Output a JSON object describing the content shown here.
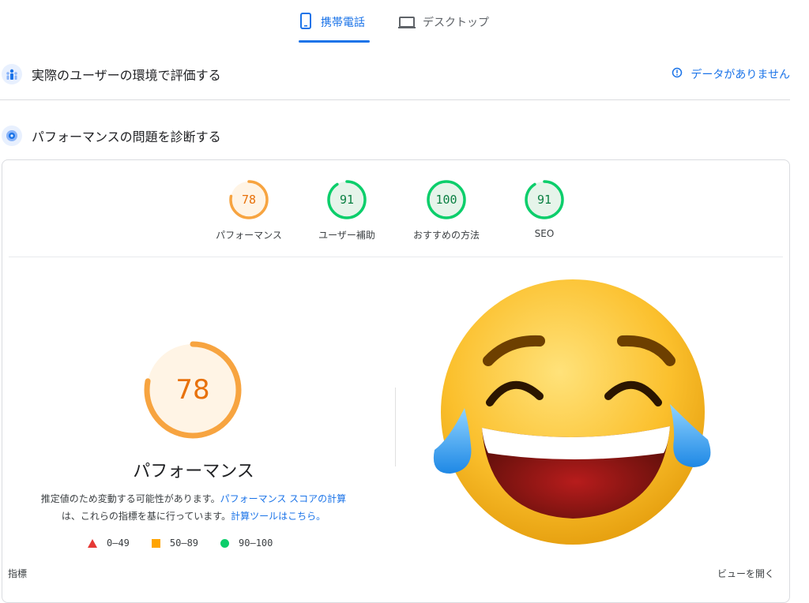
{
  "tabs": {
    "mobile": "携帯電話",
    "desktop": "デスクトップ"
  },
  "field_section": {
    "title": "実際のユーザーの環境で評価する",
    "no_data": "データがありません"
  },
  "lab_section": {
    "title": "パフォーマンスの問題を診断する"
  },
  "scores": [
    {
      "value": "78",
      "label": "パフォーマンス",
      "color": "#e8710a",
      "bg": "#fff4e5",
      "stroke": "#f7a440",
      "fraction": 0.78
    },
    {
      "value": "91",
      "label": "ユーザー補助",
      "color": "#0b8043",
      "bg": "#e6f4ea",
      "stroke": "#0cce6b",
      "fraction": 0.91
    },
    {
      "value": "100",
      "label": "おすすめの方法",
      "color": "#0b8043",
      "bg": "#e6f4ea",
      "stroke": "#0cce6b",
      "fraction": 1.0
    },
    {
      "value": "91",
      "label": "SEO",
      "color": "#0b8043",
      "bg": "#e6f4ea",
      "stroke": "#0cce6b",
      "fraction": 0.91
    }
  ],
  "performance": {
    "score": "78",
    "fraction": 0.78,
    "title": "パフォーマンス",
    "note_1": "推定値のため変動する可能性があります。",
    "note_link_1": "パフォーマンス スコアの計算",
    "note_2": "は、これらの指標を基に行っています。",
    "note_link_2": "計算ツールはこちら。"
  },
  "legend": {
    "fail": "0–49",
    "average": "50–89",
    "pass": "90–100"
  },
  "footer": {
    "left": "指標",
    "right": "ビューを開く"
  },
  "icons": {
    "mobile": "smartphone-icon",
    "desktop": "laptop-icon",
    "info": "info-icon",
    "field": "users-icon",
    "lab": "lab-icon",
    "emoji": "tears-of-joy-emoji"
  }
}
